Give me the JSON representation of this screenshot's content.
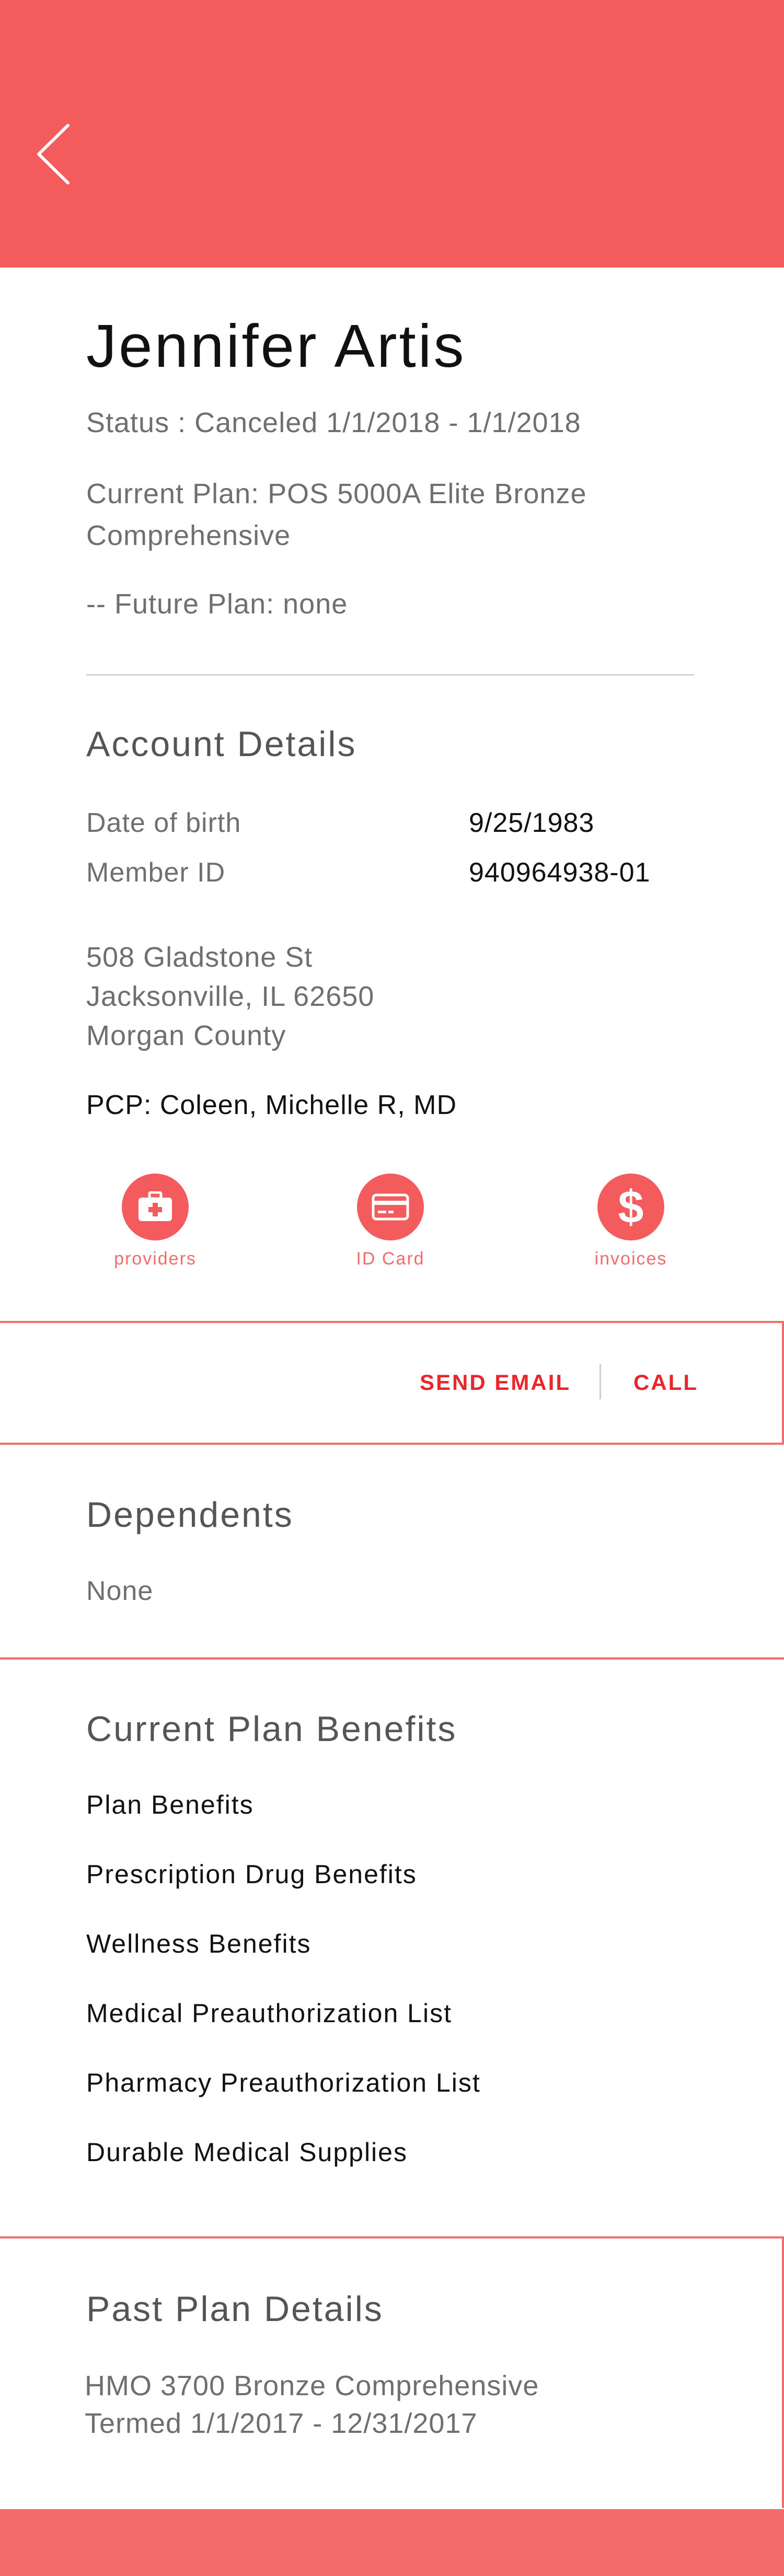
{
  "header": {
    "back_icon": "chevron-left-icon",
    "color": "#f35b5d"
  },
  "profile": {
    "name": "Jennifer Artis",
    "status": "Status : Canceled 1/1/2018 - 1/1/2018",
    "current_plan": "Current Plan: POS 5000A Elite Bronze Comprehensive",
    "future_plan": "-- Future Plan: none"
  },
  "account": {
    "title": "Account Details",
    "dob_label": "Date of birth",
    "dob_value": "9/25/1983",
    "member_id_label": "Member ID",
    "member_id_value": "940964938-01",
    "address": {
      "line1": "508 Gladstone St",
      "line2": "Jacksonville, IL 62650",
      "line3": "Morgan County"
    },
    "pcp": "PCP: Coleen, Michelle R, MD"
  },
  "actions": [
    {
      "label": "providers",
      "icon": "medical-kit-icon"
    },
    {
      "label": "ID Card",
      "icon": "card-icon"
    },
    {
      "label": "invoices",
      "icon": "dollar-icon"
    }
  ],
  "contact": {
    "email_label": "SEND EMAIL",
    "call_label": "CALL",
    "accent": "#e8262b"
  },
  "dependents": {
    "title": "Dependents",
    "value": "None"
  },
  "benefits": {
    "title": "Current Plan Benefits",
    "items": [
      "Plan Benefits",
      "Prescription Drug Benefits",
      "Wellness Benefits",
      "Medical Preauthorization List",
      "Pharmacy Preauthorization List",
      "Durable Medical Supplies"
    ]
  },
  "past_plan": {
    "title": "Past Plan Details",
    "line1": "HMO 3700 Bronze Comprehensive",
    "line2": "Termed 1/1/2017 - 12/31/2017"
  }
}
